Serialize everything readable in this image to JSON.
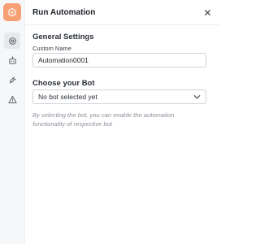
{
  "header": {
    "title": "Run Automation"
  },
  "general": {
    "section_title": "General Settings",
    "custom_name_label": "Custom Name",
    "custom_name_value": "Automation0001"
  },
  "bot": {
    "section_title": "Choose your Bot",
    "selected_value": "No bot selected yet",
    "help_text": "By selecting the bot, you can enable the automation functionality of respective bot"
  },
  "colors": {
    "accent": "#f7a073",
    "rail_bg": "#f6f7f9",
    "help_text": "#8b919a"
  },
  "icons": {
    "logo": "automation-logo-icon",
    "rail": [
      "settings-icon",
      "bot-icon",
      "plug-icon",
      "warning-icon"
    ],
    "close": "close-icon",
    "dropdown": "chevron-down-icon"
  }
}
